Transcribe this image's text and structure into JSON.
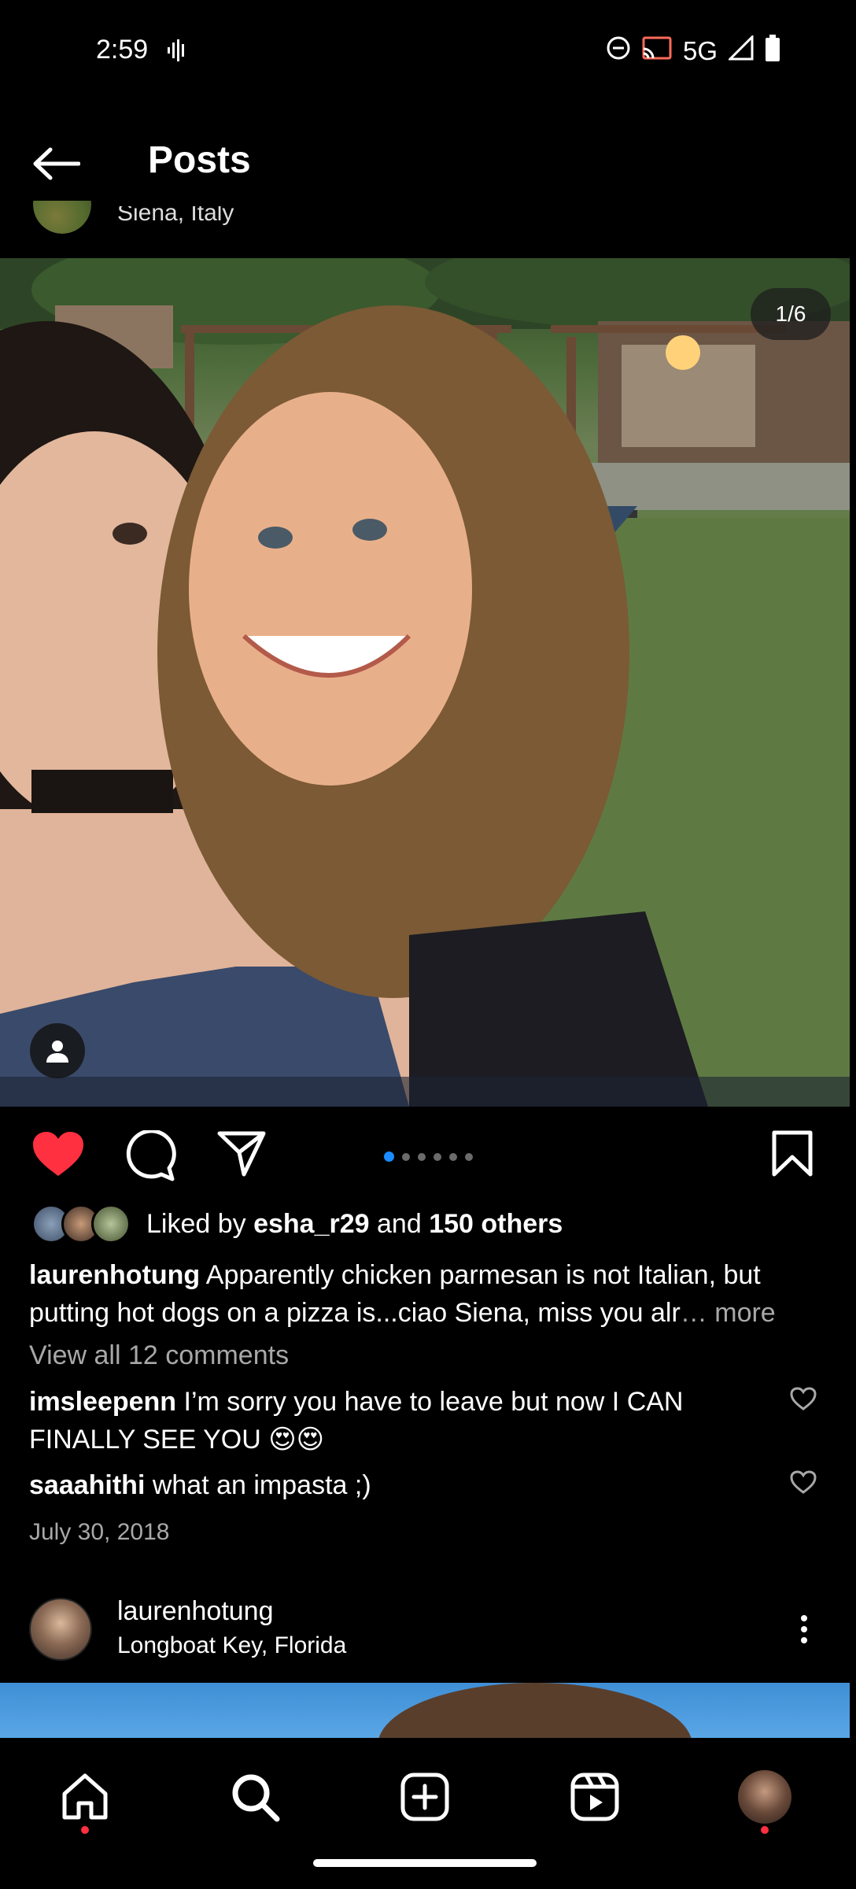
{
  "status_bar": {
    "time": "2:59",
    "network": "5G"
  },
  "header": {
    "title": "Posts"
  },
  "partial_post": {
    "location": "Siena, Italy"
  },
  "post": {
    "image_counter": "1/6",
    "carousel_total": 6,
    "carousel_active_index": 0,
    "liked": true,
    "likes": {
      "prefix": "Liked by ",
      "user": "esha_r29",
      "middle": " and ",
      "others": "150 others"
    },
    "caption": {
      "username": "laurenhotung",
      "text": "Apparently chicken parmesan is not Italian, but putting hot dogs on a pizza is...ciao Siena, miss you alr",
      "more": "… more"
    },
    "view_comments": "View all 12 comments",
    "comments": [
      {
        "username": "imsleepenn",
        "text": "I’m sorry you have to leave but now I CAN FINALLY SEE YOU 😍😍"
      },
      {
        "username": "saaahithi",
        "text": "what an impasta ;)"
      }
    ],
    "date": "July 30, 2018"
  },
  "next_post": {
    "username": "laurenhotung",
    "location": "Longboat Key, Florida"
  },
  "colors": {
    "like_red": "#ff3040",
    "carousel_active": "#1a8cff",
    "muted_text": "#a8a8a8"
  },
  "icons": {
    "back": "arrow-left-icon",
    "like": "heart-filled-icon",
    "comment": "speech-bubble-icon",
    "share": "paper-plane-icon",
    "save": "bookmark-icon",
    "tag": "person-icon",
    "nav": [
      "home-icon",
      "search-icon",
      "create-icon",
      "reels-icon",
      "profile-avatar"
    ]
  }
}
